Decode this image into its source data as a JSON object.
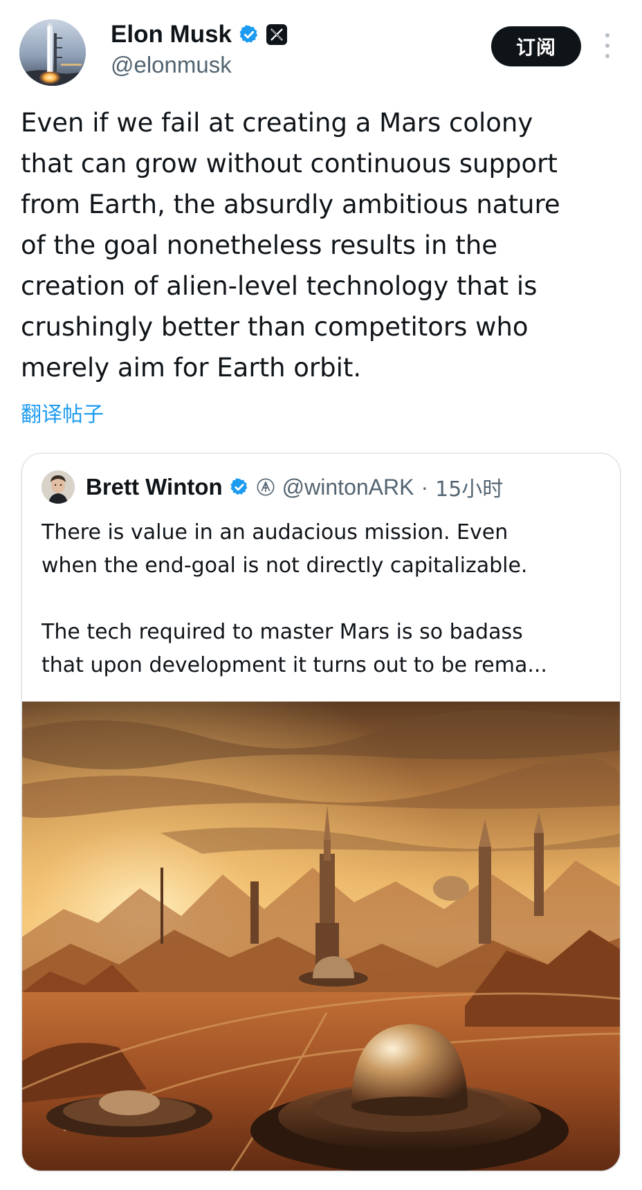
{
  "tweet": {
    "author": {
      "display_name": "Elon Musk",
      "handle": "@elonmusk",
      "verified_icon": "verified-badge-icon",
      "affiliation_icon": "x-logo-icon"
    },
    "subscribe_label": "订阅",
    "more_icon": "more-vertical-icon",
    "text": "Even if we fail at creating a Mars colony\nthat can grow without continuous support\nfrom Earth, the absurdly ambitious nature\nof the goal nonetheless results in the\ncreation of alien-level technology that is\ncrushingly better than competitors who\nmerely aim for Earth orbit.",
    "translate_label": "翻译帖子"
  },
  "quote": {
    "author": {
      "display_name": "Brett Winton",
      "handle": "@wintonARK",
      "verified_icon": "verified-badge-icon",
      "affiliation_icon": "ark-logo-icon"
    },
    "separator": "·",
    "time": "15小时",
    "paragraphs": [
      "There is value in an audacious mission. Even\nwhen the end-goal is not directly capitalizable.",
      "The tech required to master Mars is so badass\nthat upon development it turns out to be rema..."
    ],
    "image_icon": "mars-colony-image"
  },
  "colors": {
    "text_primary": "#0f1419",
    "text_secondary": "#536471",
    "link_blue": "#1d9bf0",
    "verified_blue": "#1d9bf0",
    "button_dark": "#0f1419",
    "border": "#e5e9ec"
  }
}
